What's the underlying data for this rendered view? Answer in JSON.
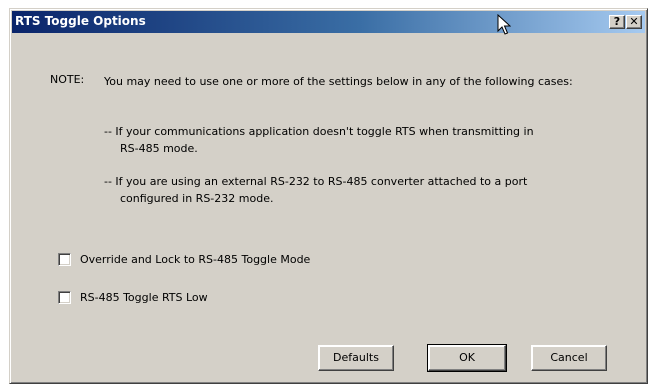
{
  "window": {
    "title": "RTS Toggle Options",
    "help_glyph": "?",
    "close_glyph": "✕"
  },
  "note": {
    "label": "NOTE:",
    "text": "You may need to use one or more of the settings below in any of the following cases:",
    "case1_line1": "-- If your communications application doesn't toggle RTS when transmitting in",
    "case1_line2": "RS-485  mode.",
    "case2_line1": "-- If you are using an external RS-232 to RS-485 converter attached to a port",
    "case2_line2": "configured in RS-232 mode."
  },
  "options": [
    {
      "label": "Override and Lock to RS-485 Toggle Mode",
      "checked": false
    },
    {
      "label": "RS-485 Toggle RTS Low",
      "checked": false
    }
  ],
  "buttons": {
    "defaults": "Defaults",
    "ok": "OK",
    "cancel": "Cancel"
  },
  "colors": {
    "dialog_face": "#d4d0c8",
    "titlebar_start": "#0a246a",
    "titlebar_end": "#a6caf0"
  },
  "icons": {
    "cursor": "mouse-pointer-icon",
    "help": "help-icon",
    "close": "close-icon"
  }
}
